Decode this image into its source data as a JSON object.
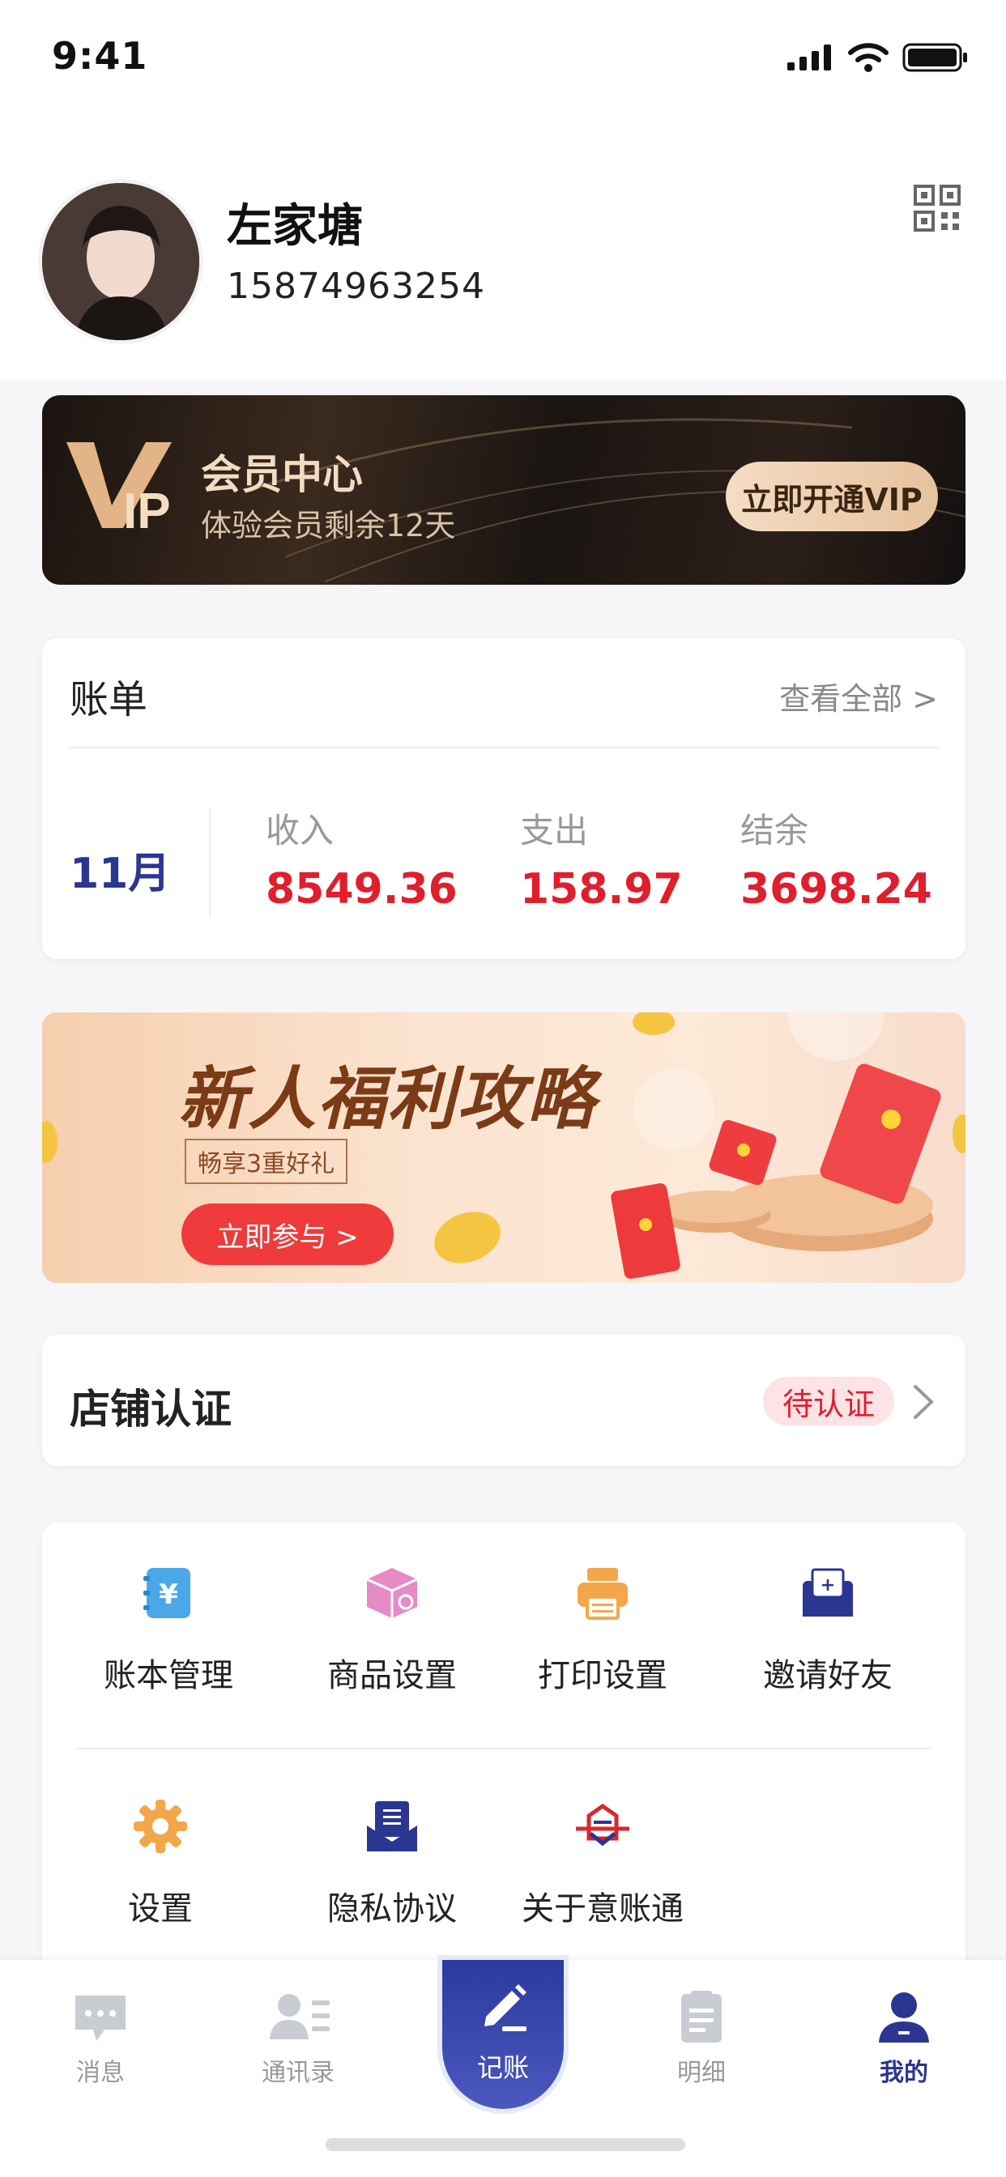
{
  "status_bar": {
    "time": "9:41"
  },
  "profile": {
    "name": "左家塘",
    "phone": "15874963254"
  },
  "vip": {
    "logo_text": "VIP",
    "title": "会员中心",
    "subtitle": "体验会员剩余12天",
    "button": "立即开通VIP"
  },
  "bill": {
    "title": "账单",
    "view_all": "查看全部 >",
    "month": "11月",
    "stats": [
      {
        "label": "收入",
        "value": "8549.36"
      },
      {
        "label": "支出",
        "value": "158.97"
      },
      {
        "label": "结余",
        "value": "3698.24"
      }
    ]
  },
  "promo": {
    "title": "新人福利攻略",
    "tag": "畅享3重好礼",
    "button": "立即参与 >"
  },
  "store": {
    "title": "店铺认证",
    "status": "待认证"
  },
  "menu": {
    "items": [
      {
        "label": "账本管理",
        "icon": "ledger-icon",
        "color": "#4aa8e8"
      },
      {
        "label": "商品设置",
        "icon": "box-icon",
        "color": "#e58bc6"
      },
      {
        "label": "打印设置",
        "icon": "printer-icon",
        "color": "#f3a74a"
      },
      {
        "label": "邀请好友",
        "icon": "invite-icon",
        "color": "#2b3592"
      },
      {
        "label": "设置",
        "icon": "gear-icon",
        "color": "#f3a74a"
      },
      {
        "label": "隐私协议",
        "icon": "privacy-icon",
        "color": "#2b3592"
      },
      {
        "label": "关于意账通",
        "icon": "about-icon",
        "color": "#d8282f"
      }
    ]
  },
  "tabbar": {
    "tabs": [
      {
        "label": "消息",
        "icon": "message-icon"
      },
      {
        "label": "通讯录",
        "icon": "contacts-icon"
      },
      {
        "label": "记账",
        "icon": "pen-icon"
      },
      {
        "label": "明细",
        "icon": "detail-icon"
      },
      {
        "label": "我的",
        "icon": "user-icon"
      }
    ],
    "active": "我的"
  },
  "colors": {
    "accent": "#2b3592",
    "red": "#e01e2c"
  }
}
